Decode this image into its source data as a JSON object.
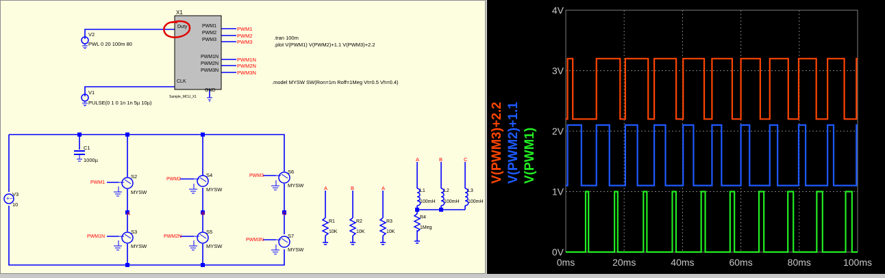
{
  "schematic": {
    "components": {
      "mcu": {
        "ref": "X1",
        "model": "Sample_MCU_X1",
        "duty": "Duty",
        "clk": "CLK",
        "gnd": "GND",
        "outputs": [
          "PWM1",
          "PWM2",
          "PWM3",
          "PWM1N",
          "PWM2N",
          "PWM3N"
        ]
      },
      "v2": {
        "ref": "V2",
        "value": "PWL 0 20 100m 80"
      },
      "v1": {
        "ref": "V1",
        "value": "PULSE(0 1 0 1n 1n 5µ 10µ)"
      },
      "v3": {
        "ref": "V3",
        "value": "10"
      },
      "c1": {
        "ref": "C1",
        "value": "1000µ"
      },
      "switches": [
        {
          "ref": "S2",
          "model": "MYSW",
          "ctrl": "PWM1"
        },
        {
          "ref": "S3",
          "model": "MYSW",
          "ctrl": "PWM1N"
        },
        {
          "ref": "S4",
          "model": "MYSW",
          "ctrl": "PWM2"
        },
        {
          "ref": "S5",
          "model": "MYSW",
          "ctrl": "PWM2N"
        },
        {
          "ref": "S6",
          "model": "MYSW",
          "ctrl": "PWM3"
        },
        {
          "ref": "S7",
          "model": "MYSW",
          "ctrl": "PWM3N"
        }
      ],
      "node_labels": {
        "a": "A",
        "b": "B",
        "c": "C"
      },
      "resistors": [
        {
          "ref": "R1",
          "value": "10K"
        },
        {
          "ref": "R2",
          "value": "10K"
        },
        {
          "ref": "R3",
          "value": "10K"
        },
        {
          "ref": "R4",
          "value": "1Meg"
        }
      ],
      "inductors": [
        {
          "ref": "L1",
          "value": "100mH"
        },
        {
          "ref": "L2",
          "value": "100mH"
        },
        {
          "ref": "L3",
          "value": "100mH"
        }
      ]
    },
    "directives": {
      "tran": ".tran 100m",
      "plot": ".plot V(PWM1) V(PWM2)+1.1 V(PWM3)+2.2",
      "model": ".model MYSW SW(Ron=1m Roff=1Meg Vt=0.5 Vh=0.4)"
    }
  },
  "colors": {
    "wire": "#0000ff",
    "net_label": "#ff0000",
    "schematic_bg": "#fdfde0",
    "plot_bg": "#000000",
    "grid": "#808080",
    "annotation_circle": "#ff0000"
  },
  "chart_data": {
    "type": "line",
    "xlim": [
      0,
      100
    ],
    "ylim": [
      0,
      4
    ],
    "x_ticks": [
      "0ms",
      "20ms",
      "40ms",
      "60ms",
      "80ms",
      "100ms"
    ],
    "y_ticks": [
      "0V",
      "1V",
      "2V",
      "3V",
      "4V"
    ],
    "grid": true,
    "legend": "left-vertical",
    "series": [
      {
        "name": "V(PWM3)+2.2",
        "color": "#ff4500",
        "low": 2.2,
        "high": 3.2,
        "first_rise": 0.6,
        "period": 9.9,
        "duty": [
          0.18,
          0.82,
          0.79,
          0.76,
          0.73,
          0.7,
          0.67,
          0.64,
          0.61,
          0.58,
          0.55
        ]
      },
      {
        "name": "V(PWM2)+1.1",
        "color": "#1e5aff",
        "low": 1.1,
        "high": 2.1,
        "first_rise": 0.6,
        "period": 9.9,
        "duty": [
          0.48,
          0.45,
          0.42,
          0.39,
          0.36,
          0.33,
          0.3,
          0.27,
          0.24,
          0.21,
          0.05
        ]
      },
      {
        "name": "V(PWM1)",
        "color": "#22ee22",
        "low": 0.0,
        "high": 1.0,
        "first_rise": 6.8,
        "period": 9.9,
        "duty": [
          0.1,
          0.11,
          0.12,
          0.13,
          0.14,
          0.15,
          0.17,
          0.19,
          0.2,
          0.22
        ]
      }
    ]
  }
}
